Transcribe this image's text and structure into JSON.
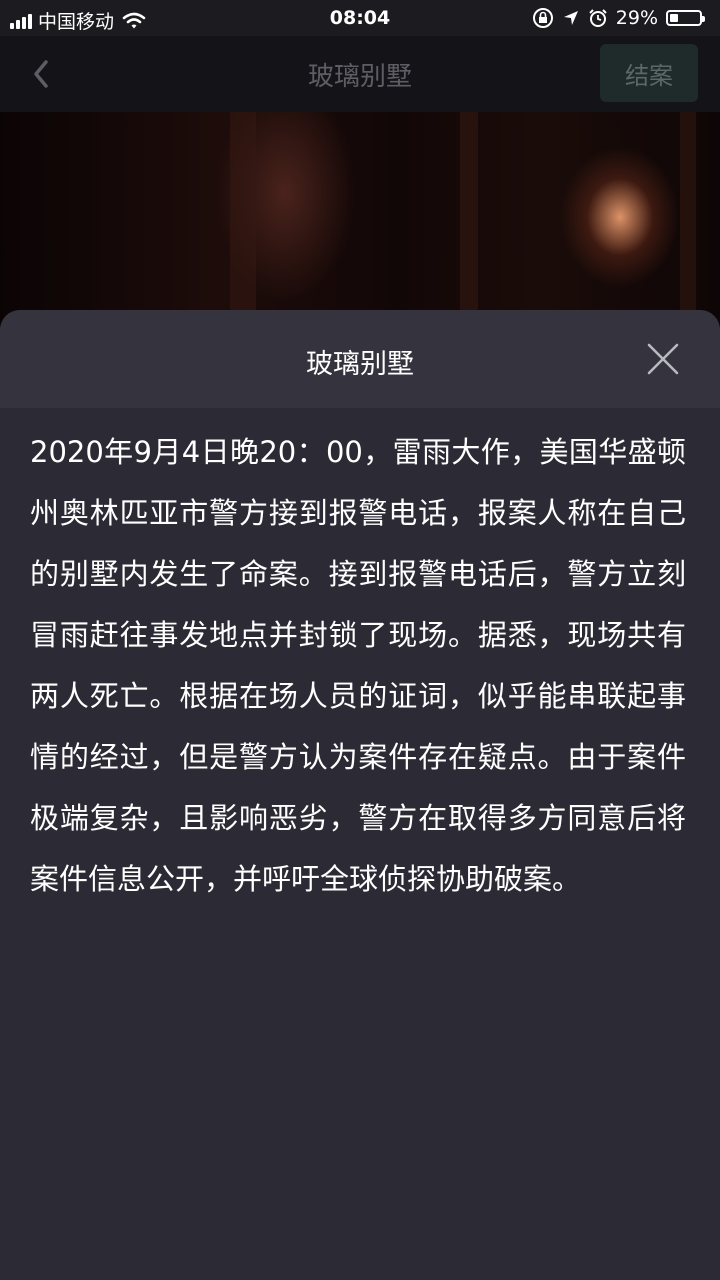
{
  "status_bar": {
    "carrier": "中国移动",
    "time": "08:04",
    "battery": "29%",
    "battery_level": 0.29
  },
  "nav": {
    "title": "玻璃别墅",
    "close_case_label": "结案"
  },
  "sheet": {
    "title": "玻璃别墅",
    "body": "2020年9月4日晚20：00，雷雨大作，美国华盛顿州奥林匹亚市警方接到报警电话，报案人称在自己的别墅内发生了命案。接到报警电话后，警方立刻冒雨赶往事发地点并封锁了现场。据悉，现场共有两人死亡。根据在场人员的证词，似乎能串联起事情的经过，但是警方认为案件存在疑点。由于案件极端复杂，且影响恶劣，警方在取得多方同意后将案件信息公开，并呼吁全球侦探协助破案。"
  },
  "icons": [
    "signal-icon",
    "wifi-icon",
    "orientation-lock-icon",
    "location-icon",
    "alarm-icon",
    "battery-icon",
    "back-chevron-icon",
    "close-icon"
  ],
  "colors": {
    "sheet_bg": "#2c2b35",
    "sheet_header_bg": "#34333e",
    "nav_bg": "#141418",
    "close_case_bg": "#1f2a2a"
  }
}
